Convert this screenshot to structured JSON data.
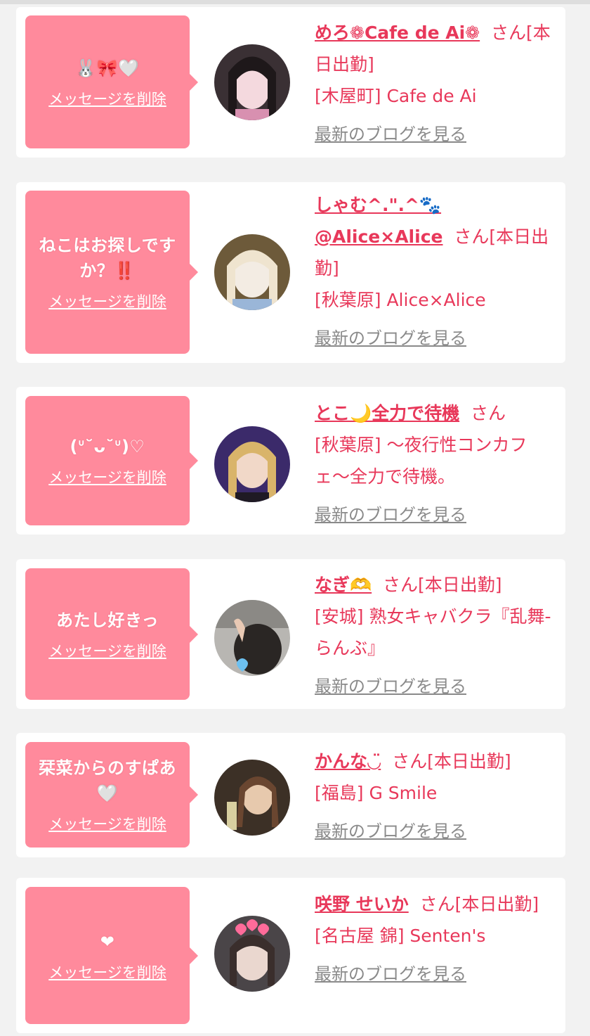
{
  "entries": [
    {
      "message": "🐰🎀🤍",
      "delete_label": "メッセージを削除",
      "name": "めろ❁Cafe de Ai❁",
      "suffix": "さん[本日出勤]",
      "shop": "[木屋町] Cafe de Ai",
      "blog_label": "最新のブログを見る",
      "avatar_colors": [
        "#3a3034",
        "#f4d9de"
      ]
    },
    {
      "message": "ねこはお探しですか？‼️",
      "delete_label": "メッセージを削除",
      "name": "しゃむ^.\".^🐾@Alice×Alice",
      "suffix": "さん[本日出勤]",
      "shop": "[秋葉原] Alice×Alice",
      "blog_label": "最新のブログを見る",
      "avatar_colors": [
        "#6d5a3a",
        "#f3ece3"
      ]
    },
    {
      "message": "(ᐡ˘ᴗ˘ᐡ)♡",
      "delete_label": "メッセージを削除",
      "name": "とこ🌙全力で待機",
      "suffix": "さん",
      "shop": "[秋葉原] 〜夜行性コンカフェ〜全力で待機。",
      "blog_label": "最新のブログを見る",
      "avatar_colors": [
        "#3b2a6a",
        "#d9b46a"
      ]
    },
    {
      "message": "あたし好きっ",
      "delete_label": "メッセージを削除",
      "name": "なぎ🫶",
      "suffix": "さん[本日出勤]",
      "shop": "[安城] 熟女キャバクラ『乱舞-らんぶ』",
      "blog_label": "最新のブログを見る",
      "avatar_colors": [
        "#8b8985",
        "#2a2624"
      ]
    },
    {
      "message": "栞菜からのすぱあ🤍",
      "delete_label": "メッセージを削除",
      "name": "かんな◡̈",
      "suffix": "さん[本日出勤]",
      "shop": "[福島] G Smile",
      "blog_label": "最新のブログを見る",
      "avatar_colors": [
        "#3c3026",
        "#e7c9ad"
      ]
    },
    {
      "message": "❤",
      "delete_label": "メッセージを削除",
      "name": "咲野 せいか",
      "suffix": "さん[本日出勤]",
      "shop": "[名古屋 錦] Senten's",
      "blog_label": "最新のブログを見る",
      "avatar_colors": [
        "#4a4548",
        "#ead7cf"
      ]
    }
  ]
}
